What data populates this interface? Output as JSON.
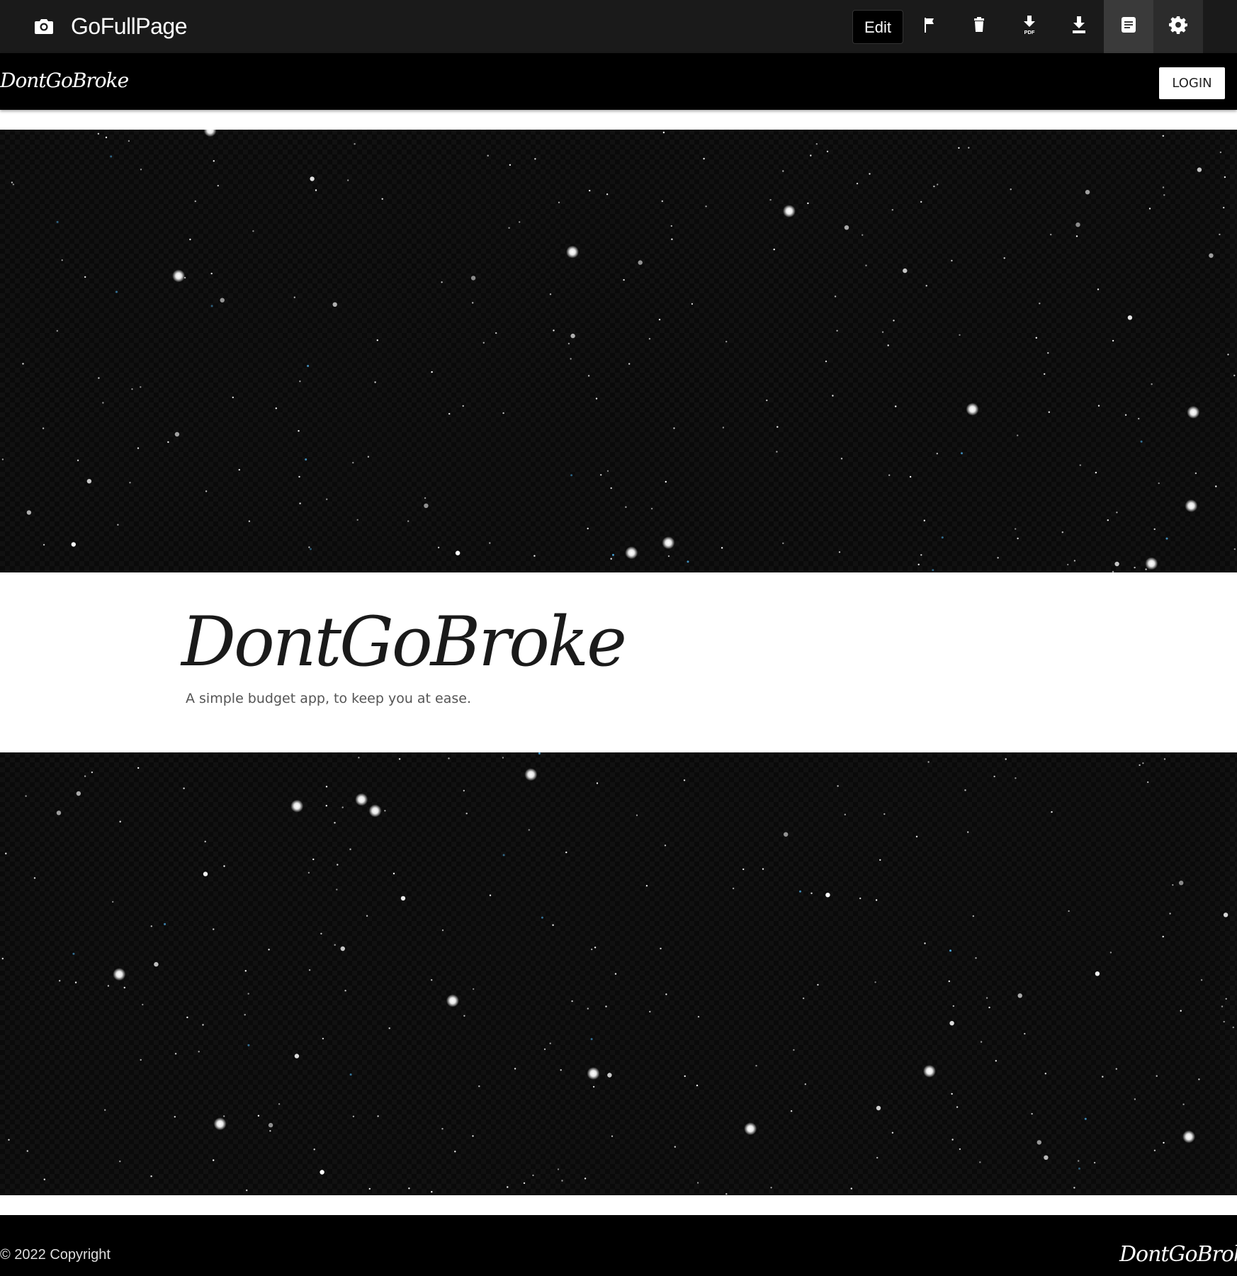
{
  "toolbar": {
    "app_title": "GoFullPage",
    "edit_label": "Edit",
    "icons": [
      "camera-icon",
      "flag-icon",
      "trash-icon",
      "download-pdf-icon",
      "download-icon",
      "notes-icon",
      "gear-icon"
    ],
    "pdf_badge": "PDF"
  },
  "nav": {
    "brand": "DontGoBroke",
    "login_label": "LOGIN"
  },
  "hero": {
    "title": "DontGoBroke",
    "subtitle": "A simple budget app, to keep you at ease."
  },
  "footer": {
    "copyright": "© 2022 Copyright",
    "brand": "DontGoBroke"
  },
  "colors": {
    "toolbar_bg": "#1a1a1a",
    "nav_bg": "#000000",
    "star_field_bg": "#0a0a0a",
    "page_bg": "#ffffff"
  }
}
